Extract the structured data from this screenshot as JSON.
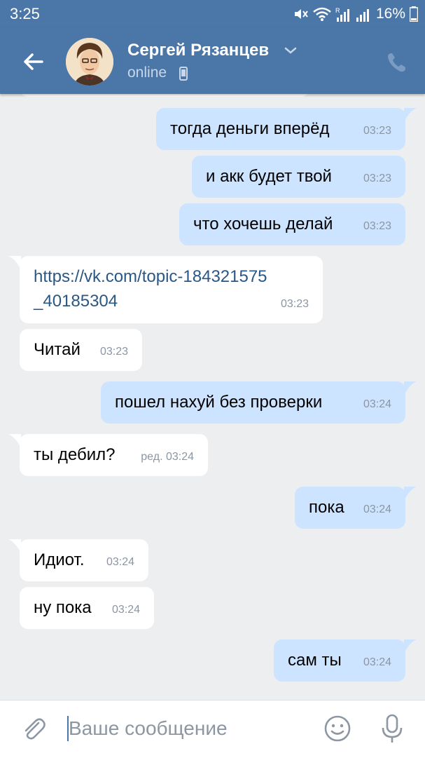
{
  "status_bar": {
    "time": "3:25",
    "battery": "16%",
    "icons": [
      "mute-icon",
      "wifi-icon",
      "signal-r-icon",
      "signal-icon",
      "battery-icon"
    ]
  },
  "header": {
    "contact_name": "Сергей Рязанцев",
    "status": "online",
    "back_icon": "arrow-left-icon",
    "call_icon": "phone-icon",
    "accent": "#4a76a8"
  },
  "messages": [
    {
      "dir": "out",
      "text": "тогда деньги вперёд",
      "time": "03:23"
    },
    {
      "dir": "out",
      "text": "и акк будет твой",
      "time": "03:23"
    },
    {
      "dir": "out",
      "text": "что хочешь делай",
      "time": "03:23"
    },
    {
      "dir": "in",
      "text_line1": "https://vk.com/topic-184321575",
      "text_line2": "_40185304",
      "time": "03:23"
    },
    {
      "dir": "in",
      "text": "Читай",
      "time": "03:23"
    },
    {
      "dir": "out",
      "text": "пошел нахуй без проверки",
      "time": "03:24"
    },
    {
      "dir": "in",
      "text": "ты дебил?",
      "time": "ред. 03:24"
    },
    {
      "dir": "out",
      "text": "пока",
      "time": "03:24"
    },
    {
      "dir": "in",
      "text": "Идиот.",
      "time": "03:24"
    },
    {
      "dir": "in",
      "text": "ну пока",
      "time": "03:24"
    },
    {
      "dir": "out",
      "text": "сам ты",
      "time": "03:24"
    }
  ],
  "colors": {
    "outgoing_bubble": "#cce4ff",
    "incoming_bubble": "#ffffff",
    "chat_background": "#edeef0",
    "link": "#2a5885"
  },
  "input": {
    "placeholder": "Ваше сообщение",
    "value": ""
  }
}
